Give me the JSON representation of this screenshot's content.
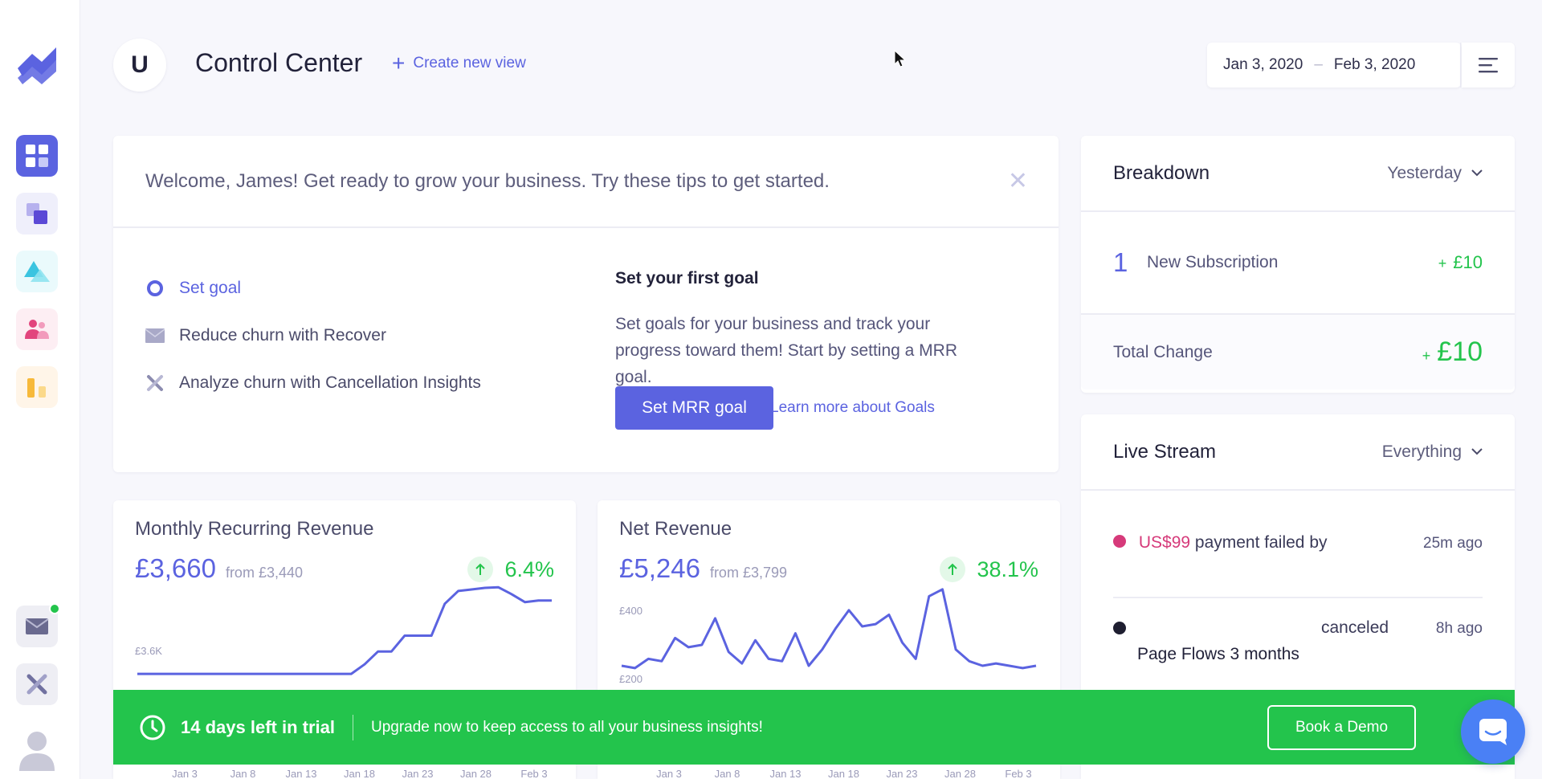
{
  "colors": {
    "accent": "#5b63e0",
    "positive": "#23c44c",
    "negative": "#d63a7a",
    "banner": "#23c44c"
  },
  "sidebar": {
    "items": [
      {
        "icon": "dashboard-icon",
        "active": true
      },
      {
        "icon": "layers-icon"
      },
      {
        "icon": "triangles-icon"
      },
      {
        "icon": "users-icon"
      },
      {
        "icon": "bar-chart-icon"
      }
    ],
    "bottom": [
      {
        "icon": "mail-icon",
        "notification": true
      },
      {
        "icon": "cancellation-icon"
      },
      {
        "icon": "profile-icon"
      }
    ]
  },
  "header": {
    "avatar_letter": "U",
    "title": "Control Center",
    "create_view_label": "Create new view",
    "date_start": "Jan 3, 2020",
    "date_sep": "–",
    "date_end": "Feb 3, 2020"
  },
  "welcome": {
    "heading": "Welcome, James! Get ready to grow your business. Try these tips to get started.",
    "close": "✕",
    "tips": [
      {
        "label": "Set goal",
        "icon": "radio-icon"
      },
      {
        "label": "Reduce churn with Recover",
        "icon": "envelope-icon"
      },
      {
        "label": "Analyze churn with Cancellation Insights",
        "icon": "x-icon"
      }
    ],
    "goal_title": "Set your first goal",
    "goal_text": "Set goals for your business and track your progress toward them! Start by setting a MRR goal.",
    "primary_button": "Set MRR goal",
    "learn_link": "Learn more about Goals"
  },
  "mrr": {
    "title": "Monthly Recurring Revenue",
    "value": "£3,660",
    "from": "from £3,440",
    "change": "6.4%"
  },
  "net": {
    "title": "Net Revenue",
    "value": "£5,246",
    "from": "from £3,799",
    "change": "38.1%"
  },
  "chart_data": [
    {
      "type": "line",
      "title": "Monthly Recurring Revenue",
      "ytick_labels": [
        "£3.6K"
      ],
      "x_ticks": [
        "Jan 3",
        "Jan 8",
        "Jan 13",
        "Jan 18",
        "Jan 23",
        "Jan 28",
        "Feb 3"
      ],
      "x": [
        "Jan 3",
        "Jan 4",
        "Jan 5",
        "Jan 6",
        "Jan 7",
        "Jan 8",
        "Jan 9",
        "Jan 10",
        "Jan 11",
        "Jan 12",
        "Jan 13",
        "Jan 14",
        "Jan 15",
        "Jan 16",
        "Jan 17",
        "Jan 18",
        "Jan 19",
        "Jan 20",
        "Jan 21",
        "Jan 22",
        "Jan 23",
        "Jan 24",
        "Jan 25",
        "Jan 26",
        "Jan 27",
        "Jan 28",
        "Jan 29",
        "Jan 30",
        "Jan 31",
        "Feb 1",
        "Feb 2",
        "Feb 3"
      ],
      "values": [
        3440,
        3440,
        3440,
        3440,
        3440,
        3440,
        3440,
        3440,
        3440,
        3440,
        3440,
        3440,
        3440,
        3440,
        3440,
        3440,
        3440,
        3470,
        3510,
        3510,
        3560,
        3560,
        3560,
        3660,
        3700,
        3705,
        3710,
        3712,
        3690,
        3665,
        3670,
        3670
      ],
      "ylim": [
        3400,
        3720
      ]
    },
    {
      "type": "line",
      "title": "Net Revenue",
      "ytick_labels": [
        "£400",
        "£200"
      ],
      "x_ticks": [
        "Jan 3",
        "Jan 8",
        "Jan 13",
        "Jan 18",
        "Jan 23",
        "Jan 28",
        "Feb 3"
      ],
      "x": [
        "Jan 3",
        "Jan 4",
        "Jan 5",
        "Jan 6",
        "Jan 7",
        "Jan 8",
        "Jan 9",
        "Jan 10",
        "Jan 11",
        "Jan 12",
        "Jan 13",
        "Jan 14",
        "Jan 15",
        "Jan 16",
        "Jan 17",
        "Jan 18",
        "Jan 19",
        "Jan 20",
        "Jan 21",
        "Jan 22",
        "Jan 23",
        "Jan 24",
        "Jan 25",
        "Jan 26",
        "Jan 27",
        "Jan 28",
        "Jan 29",
        "Jan 30",
        "Jan 31",
        "Feb 1",
        "Feb 2",
        "Feb 3"
      ],
      "values": [
        90,
        80,
        120,
        110,
        210,
        170,
        180,
        295,
        150,
        100,
        200,
        120,
        110,
        230,
        90,
        160,
        250,
        330,
        260,
        270,
        310,
        190,
        120,
        390,
        420,
        160,
        110,
        90,
        100,
        90,
        80,
        90
      ],
      "ylim": [
        0,
        440
      ]
    }
  ],
  "breakdown": {
    "title": "Breakdown",
    "period": "Yesterday",
    "row_count": "1",
    "row_label": "New Subscription",
    "row_plus": "+",
    "row_amount": "£10",
    "total_label": "Total Change",
    "total_plus": "+",
    "total_amount": "£10"
  },
  "livestream": {
    "title": "Live Stream",
    "filter": "Everything",
    "events": [
      {
        "amount": "US$99",
        "text": "payment failed by",
        "time": "25m ago",
        "dot": "#d63a7a"
      },
      {
        "action": "canceled",
        "text": "Page Flows 3 months",
        "time": "8h ago",
        "dot": "#1e1e30"
      }
    ]
  },
  "trial": {
    "days": "14 days left in trial",
    "message": "Upgrade now to keep access to all your business insights!",
    "button": "Book a Demo"
  }
}
